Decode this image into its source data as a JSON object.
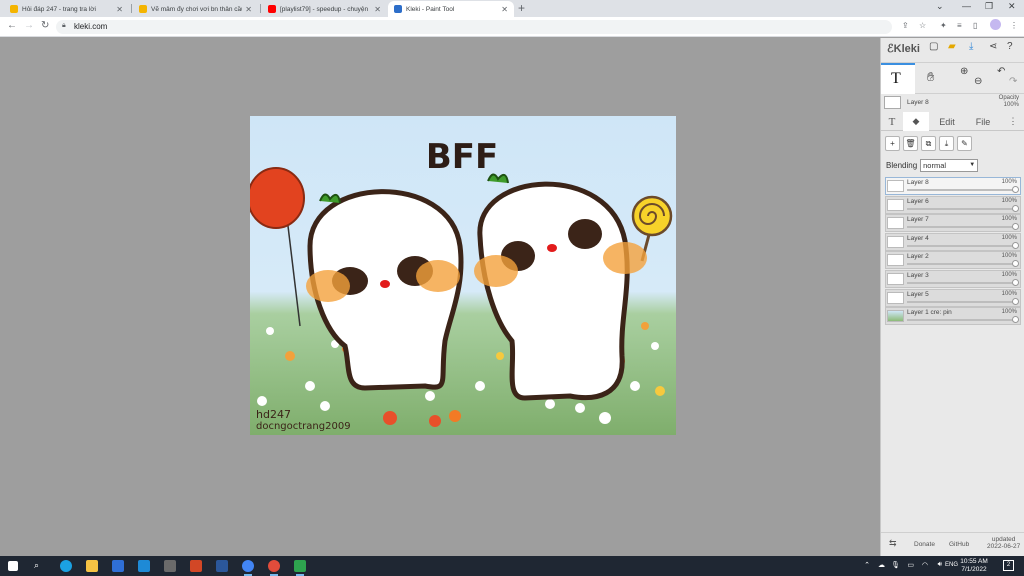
{
  "browser": {
    "tabs": [
      {
        "title": "Hỏi đáp 247 - trang tra lời",
        "active": false
      },
      {
        "title": "Vẽ mâm đy chơi vơi bn thân cầu",
        "active": false
      },
      {
        "title": "[playlist79] - speedup - chuyện",
        "active": false
      },
      {
        "title": "Kleki - Paint Tool",
        "active": true
      }
    ],
    "url": "kleki.com",
    "icons": [
      "back-icon",
      "forward-icon",
      "reload-icon",
      "lock-icon",
      "share-icon",
      "star-icon",
      "extensions-icon",
      "reading-list-icon",
      "sidebar-icon",
      "profile-icon",
      "menu-icon"
    ]
  },
  "app": {
    "brand": "Kleki",
    "current_layer": "Layer 8",
    "opacity_label": "Opacity",
    "opacity_value": "100%",
    "panel_tabs": {
      "text_icon": "T",
      "edit": "Edit",
      "file": "File"
    },
    "blending_label": "Blending",
    "blending_value": "normal",
    "layers": [
      {
        "name": "Layer 8",
        "opacity": "100%",
        "selected": true
      },
      {
        "name": "Layer 6",
        "opacity": "100%",
        "selected": false
      },
      {
        "name": "Layer 7",
        "opacity": "100%",
        "selected": false
      },
      {
        "name": "Layer 4",
        "opacity": "100%",
        "selected": false
      },
      {
        "name": "Layer 2",
        "opacity": "100%",
        "selected": false
      },
      {
        "name": "Layer 3",
        "opacity": "100%",
        "selected": false
      },
      {
        "name": "Layer 5",
        "opacity": "100%",
        "selected": false
      },
      {
        "name": "Layer 1 cre: pin",
        "opacity": "100%",
        "selected": false
      }
    ],
    "footer": {
      "donate": "Donate",
      "github": "GitHub",
      "updated_label": "updated",
      "updated_date": "2022-06-27"
    }
  },
  "artwork": {
    "title": "BFF",
    "watermark_1": "hd247",
    "watermark_2": "docngoctrang2009"
  },
  "taskbar": {
    "time": "10:55 AM",
    "date": "7/1/2022",
    "lang": "ENG",
    "notifications": "2"
  }
}
